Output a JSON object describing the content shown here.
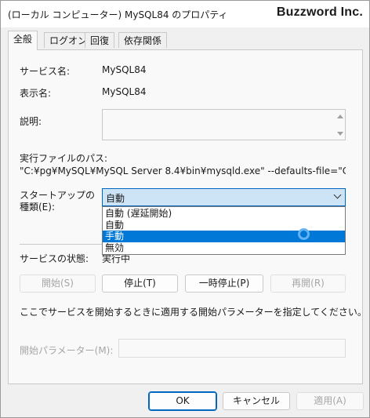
{
  "window": {
    "title": "(ローカル コンピューター) MySQL84 のプロパティ",
    "brand": "Buzzword Inc."
  },
  "tabs": [
    {
      "label": "全般",
      "active": true
    },
    {
      "label": "ログオン"
    },
    {
      "label": "回復"
    },
    {
      "label": "依存関係"
    }
  ],
  "general": {
    "service_name_label": "サービス名:",
    "service_name_value": "MySQL84",
    "display_name_label": "表示名:",
    "display_name_value": "MySQL84",
    "description_label": "説明:",
    "description_value": "",
    "exe_path_label": "実行ファイルのパス:",
    "exe_path_value": "\"C:¥pg¥MySQL¥MySQL Server 8.4¥bin¥mysqld.exe\" --defaults-file=\"C:¥Program",
    "startup_type_label_line1": "スタートアップの",
    "startup_type_label_line2": "種類(E):",
    "startup_type_selected": "自動",
    "startup_options": [
      "自動 (遅延開始)",
      "自動",
      "手動",
      "無効"
    ],
    "startup_option_highlighted": "手動",
    "service_status_label": "サービスの状態:",
    "service_status_value": "実行中",
    "buttons": {
      "start": "開始(S)",
      "stop": "停止(T)",
      "pause": "一時停止(P)",
      "resume": "再開(R)"
    },
    "hint": "ここでサービスを開始するときに適用する開始パラメーターを指定してください。",
    "start_params_label": "開始パラメーター(M):",
    "start_params_value": ""
  },
  "footer": {
    "ok": "OK",
    "cancel": "キャンセル",
    "apply": "適用(A)"
  },
  "colors": {
    "accent": "#0067c0",
    "selection": "#0078d7",
    "select_bg": "#cde4f7"
  }
}
